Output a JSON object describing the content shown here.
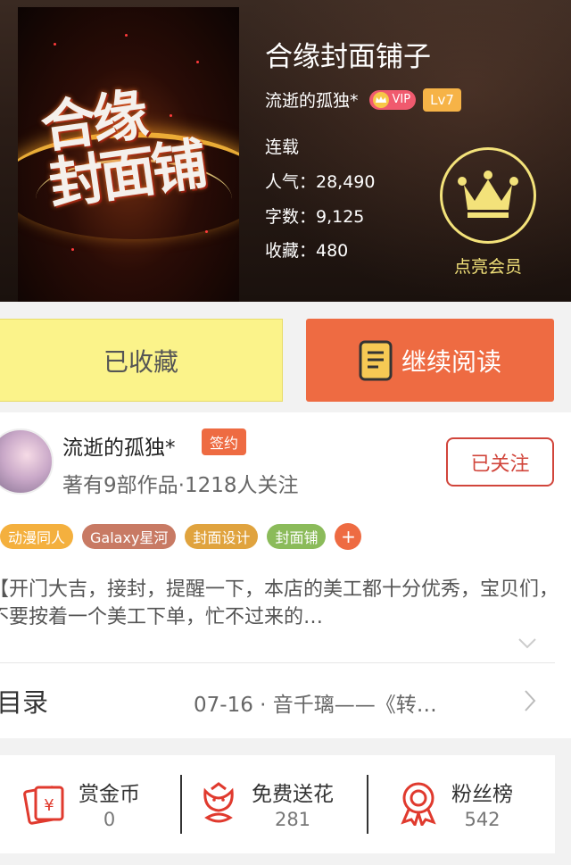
{
  "book": {
    "title": "合缘封面铺子",
    "cover_text_line1": "合缘",
    "cover_text_line2": "封面铺",
    "author": "流逝的孤独*",
    "vip_label": "VIP",
    "level": "Lv7",
    "status": "连载",
    "popularity": "人气：28,490",
    "word_count": "字数：9,125",
    "favorites": "收藏：480"
  },
  "member": {
    "label": "点亮会员"
  },
  "actions": {
    "collected_label": "已收藏",
    "read_label": "继续阅读"
  },
  "author_card": {
    "name": "流逝的孤独*",
    "sign_badge": "签约",
    "subtitle": "著有9部作品·1218人关注",
    "follow_label": "已关注"
  },
  "tags": [
    {
      "label": "动漫同人",
      "color": "#f4b03e"
    },
    {
      "label": "Galaxy星河",
      "color": "#c87a64"
    },
    {
      "label": "封面设计",
      "color": "#e0a33e"
    },
    {
      "label": "封面铺",
      "color": "#8bbb5a"
    },
    {
      "label": "+",
      "color": "#ee6b42"
    }
  ],
  "description": "【开门大吉，接封，提醒一下，本店的美工都十分优秀，宝贝们，不要按着一个美工下单，忙不过来的…",
  "toc": {
    "label": "目录",
    "latest": "07-16 · 音千璃——《转…"
  },
  "stats": [
    {
      "label": "赏金币",
      "value": "0",
      "icon": "red-envelope-icon"
    },
    {
      "label": "免费送花",
      "value": "281",
      "icon": "flower-icon"
    },
    {
      "label": "粉丝榜",
      "value": "542",
      "icon": "medal-icon"
    }
  ],
  "colors": {
    "accent": "#ee6b42",
    "follow_red": "#d1453b",
    "collected_yellow": "#fbf38a",
    "member_gold": "#f3e27a"
  }
}
